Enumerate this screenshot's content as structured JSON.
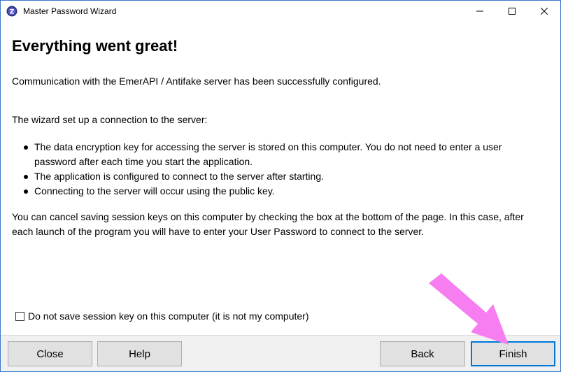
{
  "window": {
    "title": "Master Password Wizard",
    "controls": {
      "minimize": "—",
      "maximize": "☐",
      "close": "✕"
    }
  },
  "content": {
    "heading": "Everything went great!",
    "intro": "Communication with the EmerAPI / Antifake server has been successfully configured.",
    "setup_intro": "The wizard set up a connection to the server:",
    "bullets": [
      "The data encryption key for accessing the server is stored on this computer. You do not need to enter a user password after each time you start the application.",
      "The application is configured to connect to the server after starting.",
      "Connecting to the server will occur using the public key."
    ],
    "note": "You can cancel saving session keys on this computer by checking the box at the bottom of the page. In this case, after each launch of the program you will have to enter your User Password to connect to the server."
  },
  "checkbox": {
    "label": "Do not save session key on this computer (it is not my computer)",
    "checked": false
  },
  "buttons": {
    "close": "Close",
    "help": "Help",
    "back": "Back",
    "finish": "Finish"
  },
  "colors": {
    "accent": "#0078d7",
    "annotation_arrow": "#f77ef0",
    "window_border": "#3c78c8"
  },
  "icons": {
    "app": "app-logo-icon",
    "annotation": "pointer-arrow-annotation"
  }
}
